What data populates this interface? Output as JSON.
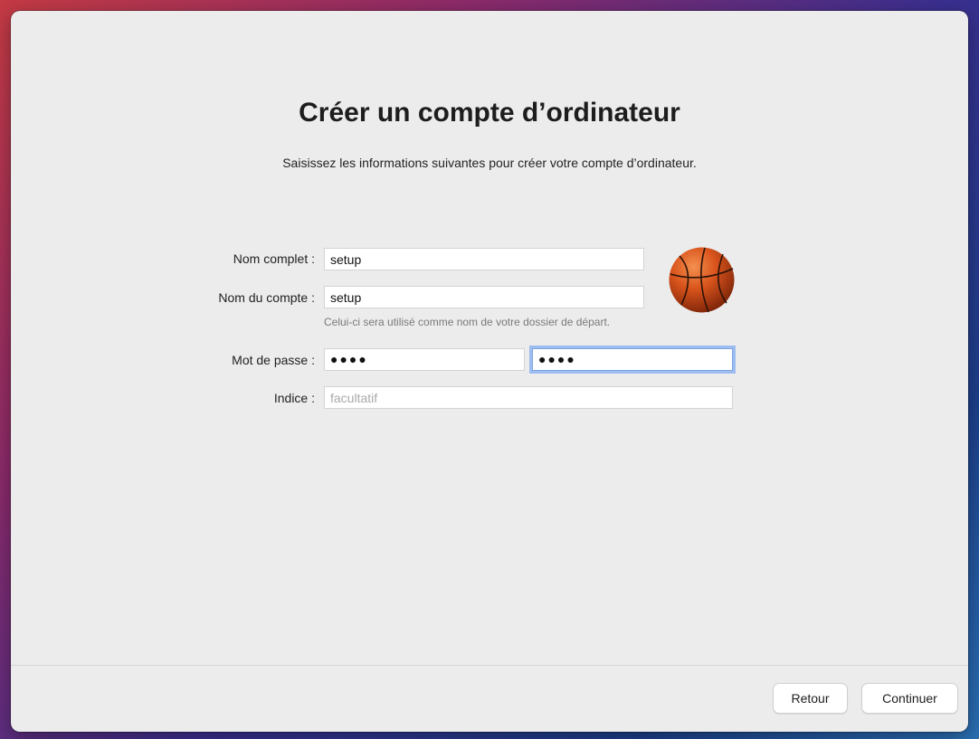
{
  "window": {
    "title": "Créer un compte d’ordinateur",
    "subtitle": "Saisissez les informations suivantes pour créer votre compte d’ordinateur."
  },
  "form": {
    "full_name": {
      "label": "Nom complet :",
      "value": "setup"
    },
    "account_name": {
      "label": "Nom du compte :",
      "value": "setup",
      "help": "Celui-ci sera utilisé comme nom de votre dossier de départ."
    },
    "password": {
      "label": "Mot de passe :",
      "value": "●●●●",
      "verify_value": "●●●●"
    },
    "hint": {
      "label": "Indice :",
      "value": "",
      "placeholder": "facultatif"
    }
  },
  "avatar": {
    "icon": "basketball-icon"
  },
  "footer": {
    "back_label": "Retour",
    "continue_label": "Continuer"
  },
  "colors": {
    "window_bg": "#ececec",
    "focus_ring": "#9dbdf0",
    "avatar_orange": "#d9541c"
  }
}
